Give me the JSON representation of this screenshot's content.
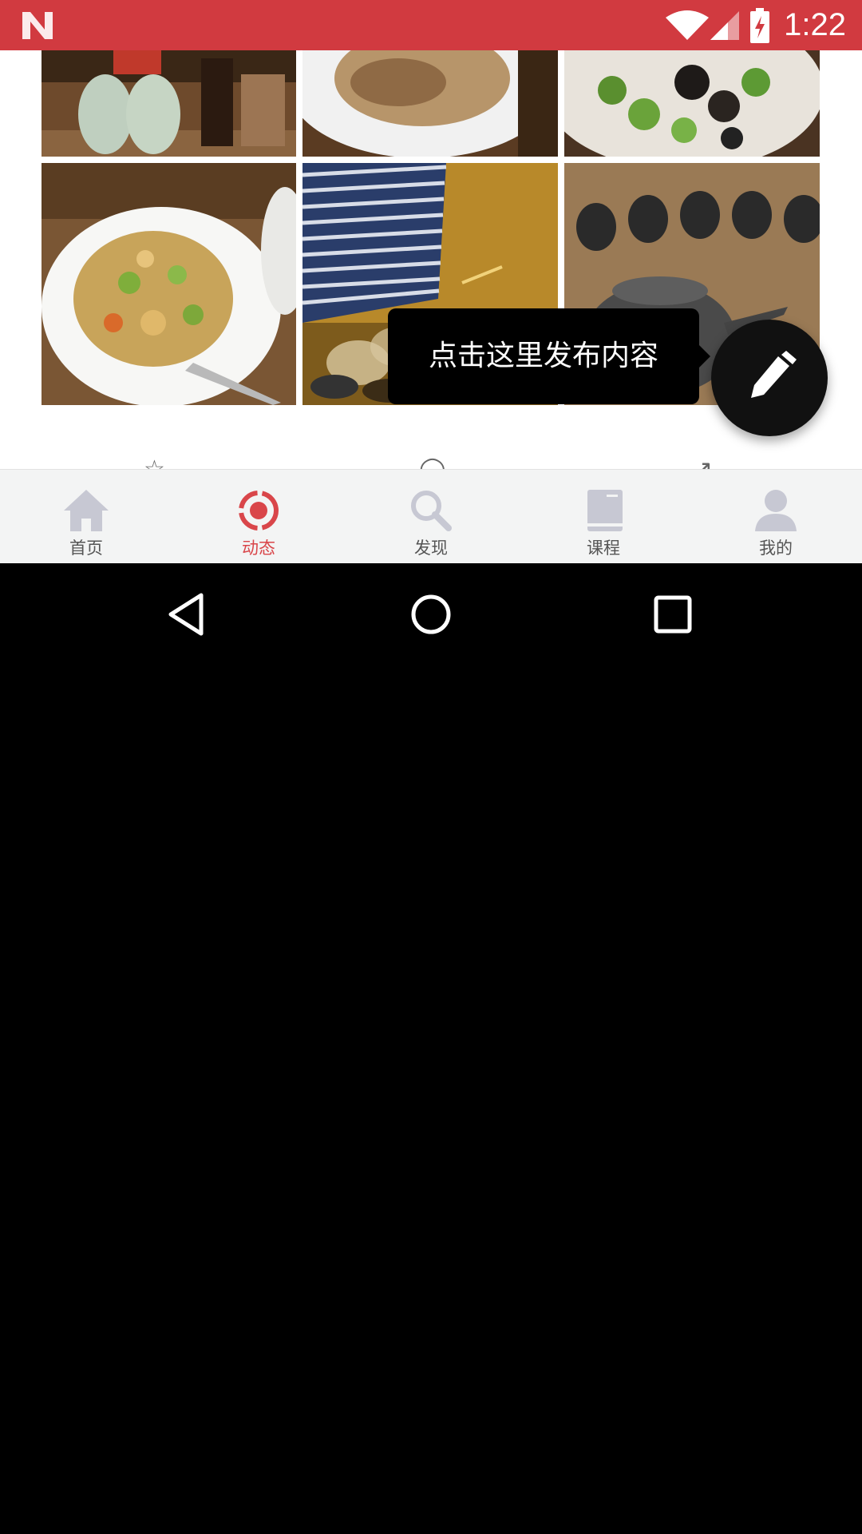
{
  "status_bar": {
    "time": "1:22",
    "background_color": "#d13a40",
    "icons": [
      "n-notification-icon",
      "wifi-icon",
      "signal-icon",
      "battery-charging-icon"
    ]
  },
  "photo_grid": {
    "photos": [
      {
        "name": "bottles-photo"
      },
      {
        "name": "fish-plate-photo"
      },
      {
        "name": "broccoli-mushroom-photo"
      },
      {
        "name": "stir-fry-plate-photo"
      },
      {
        "name": "window-blinds-photo"
      },
      {
        "name": "tea-set-photo"
      }
    ]
  },
  "tooltip": {
    "text": "点击这里发布内容"
  },
  "fab": {
    "icon": "pencil-icon"
  },
  "tabbar": {
    "tabs": [
      {
        "label": "首页",
        "icon": "home-icon",
        "active": false
      },
      {
        "label": "动态",
        "icon": "feed-icon",
        "active": true
      },
      {
        "label": "发现",
        "icon": "search-icon",
        "active": false
      },
      {
        "label": "课程",
        "icon": "book-icon",
        "active": false
      },
      {
        "label": "我的",
        "icon": "profile-icon",
        "active": false
      }
    ],
    "active_color": "#d9464a",
    "inactive_icon_color": "#c7c8d3"
  },
  "navbar": {
    "buttons": [
      "back-icon",
      "home-circle-icon",
      "recents-icon"
    ]
  }
}
